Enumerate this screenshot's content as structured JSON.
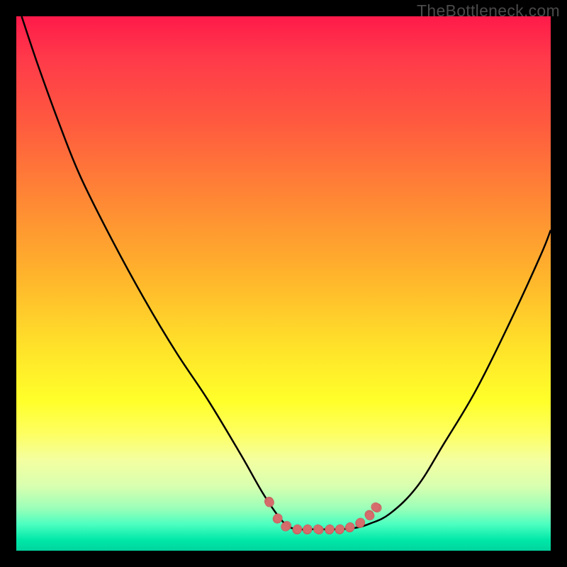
{
  "watermark": "TheBottleneck.com",
  "colors": {
    "curveStroke": "#000000",
    "markerFill": "#d66b6b",
    "markerStroke": "#c85858"
  },
  "chart_data": {
    "type": "line",
    "title": "",
    "xlabel": "",
    "ylabel": "",
    "xlim": [
      0,
      100
    ],
    "ylim": [
      0,
      100
    ],
    "grid": false,
    "series": [
      {
        "name": "curve",
        "x": [
          1,
          4,
          8,
          12,
          18,
          24,
          30,
          36,
          42,
          46,
          49,
          51,
          53,
          55,
          57,
          60,
          63,
          66,
          70,
          75,
          80,
          86,
          92,
          98,
          100
        ],
        "y": [
          100,
          91,
          80,
          70,
          58,
          47,
          37,
          28,
          18,
          11,
          6.5,
          4.5,
          4,
          4,
          4,
          4,
          4.2,
          5,
          7,
          12,
          20,
          30,
          42,
          55,
          60
        ]
      }
    ],
    "markers": {
      "name": "highlight",
      "x": [
        47,
        49,
        51,
        53,
        55,
        57,
        59,
        61,
        63,
        64.5,
        66
      ],
      "y": [
        9,
        6,
        4.5,
        4,
        4,
        4,
        4,
        4.1,
        4.3,
        5.2,
        6.3
      ]
    },
    "marker_groups": [
      {
        "cx": 47.2,
        "cy": 9.2,
        "n": 2,
        "spread": 1.0
      },
      {
        "cx": 49.0,
        "cy": 6.0,
        "n": 2,
        "spread": 1.0
      },
      {
        "cx": 50.5,
        "cy": 4.6,
        "n": 2,
        "spread": 0.9
      },
      {
        "cx": 52.5,
        "cy": 4.0,
        "n": 2,
        "spread": 0.9
      },
      {
        "cx": 54.5,
        "cy": 4.0,
        "n": 2,
        "spread": 0.9
      },
      {
        "cx": 56.5,
        "cy": 4.0,
        "n": 2,
        "spread": 0.9
      },
      {
        "cx": 58.5,
        "cy": 4.0,
        "n": 2,
        "spread": 0.9
      },
      {
        "cx": 60.5,
        "cy": 4.1,
        "n": 2,
        "spread": 0.9
      },
      {
        "cx": 62.5,
        "cy": 4.3,
        "n": 2,
        "spread": 0.9
      },
      {
        "cx": 64.3,
        "cy": 5.2,
        "n": 2,
        "spread": 1.0
      },
      {
        "cx": 66.0,
        "cy": 6.6,
        "n": 2,
        "spread": 1.0
      },
      {
        "cx": 67.3,
        "cy": 8.2,
        "n": 2,
        "spread": 1.0
      }
    ]
  }
}
